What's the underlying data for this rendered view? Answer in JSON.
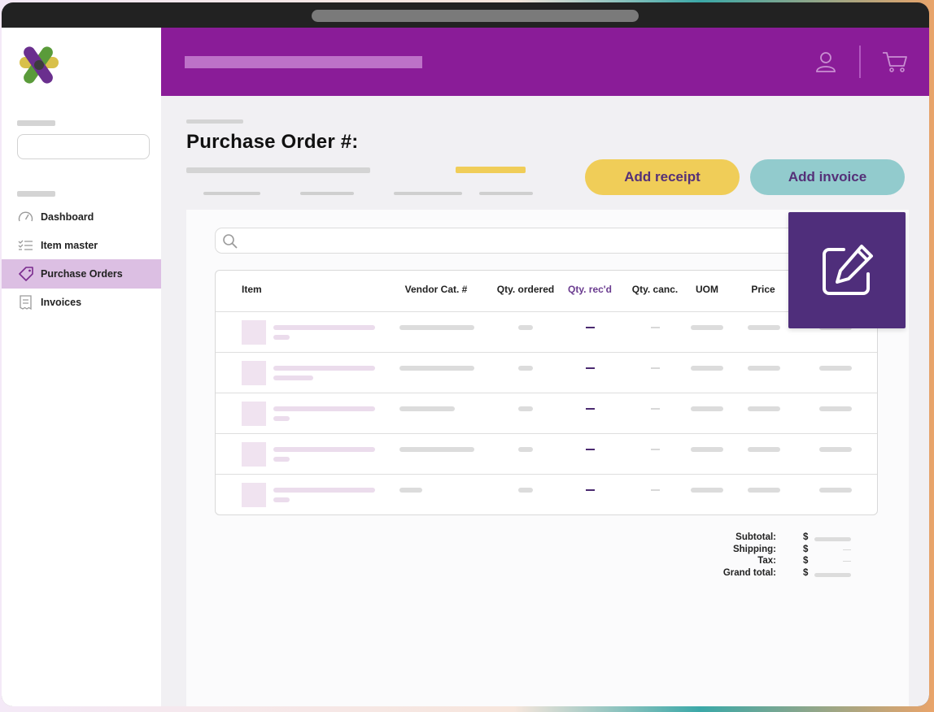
{
  "page": {
    "title": "Purchase Order #:",
    "actions": {
      "add_receipt": "Add receipt",
      "add_invoice": "Add invoice"
    }
  },
  "sidebar": {
    "items": [
      {
        "label": "Dashboard",
        "icon": "gauge-icon"
      },
      {
        "label": "Item master",
        "icon": "list-icon"
      },
      {
        "label": "Purchase Orders",
        "icon": "tag-icon",
        "active": true
      },
      {
        "label": "Invoices",
        "icon": "receipt-icon"
      }
    ]
  },
  "header": {
    "icons": [
      "user-icon",
      "cart-icon"
    ]
  },
  "table": {
    "columns": [
      "Item",
      "Vendor Cat. #",
      "Qty. ordered",
      "Qty. rec'd",
      "Qty. canc.",
      "UOM",
      "Price"
    ]
  },
  "totals": {
    "subtotal_label": "Subtotal:",
    "shipping_label": "Shipping:",
    "tax_label": "Tax:",
    "grand_total_label": "Grand total:",
    "currency": "$"
  },
  "colors": {
    "brand_purple": "#8a1c98",
    "active_nav": "#dcbfe3",
    "receipt_button": "#f0cd58",
    "invoice_button": "#92cbcd",
    "edit_card": "#4f2e7b",
    "accent_text": "#553078"
  }
}
